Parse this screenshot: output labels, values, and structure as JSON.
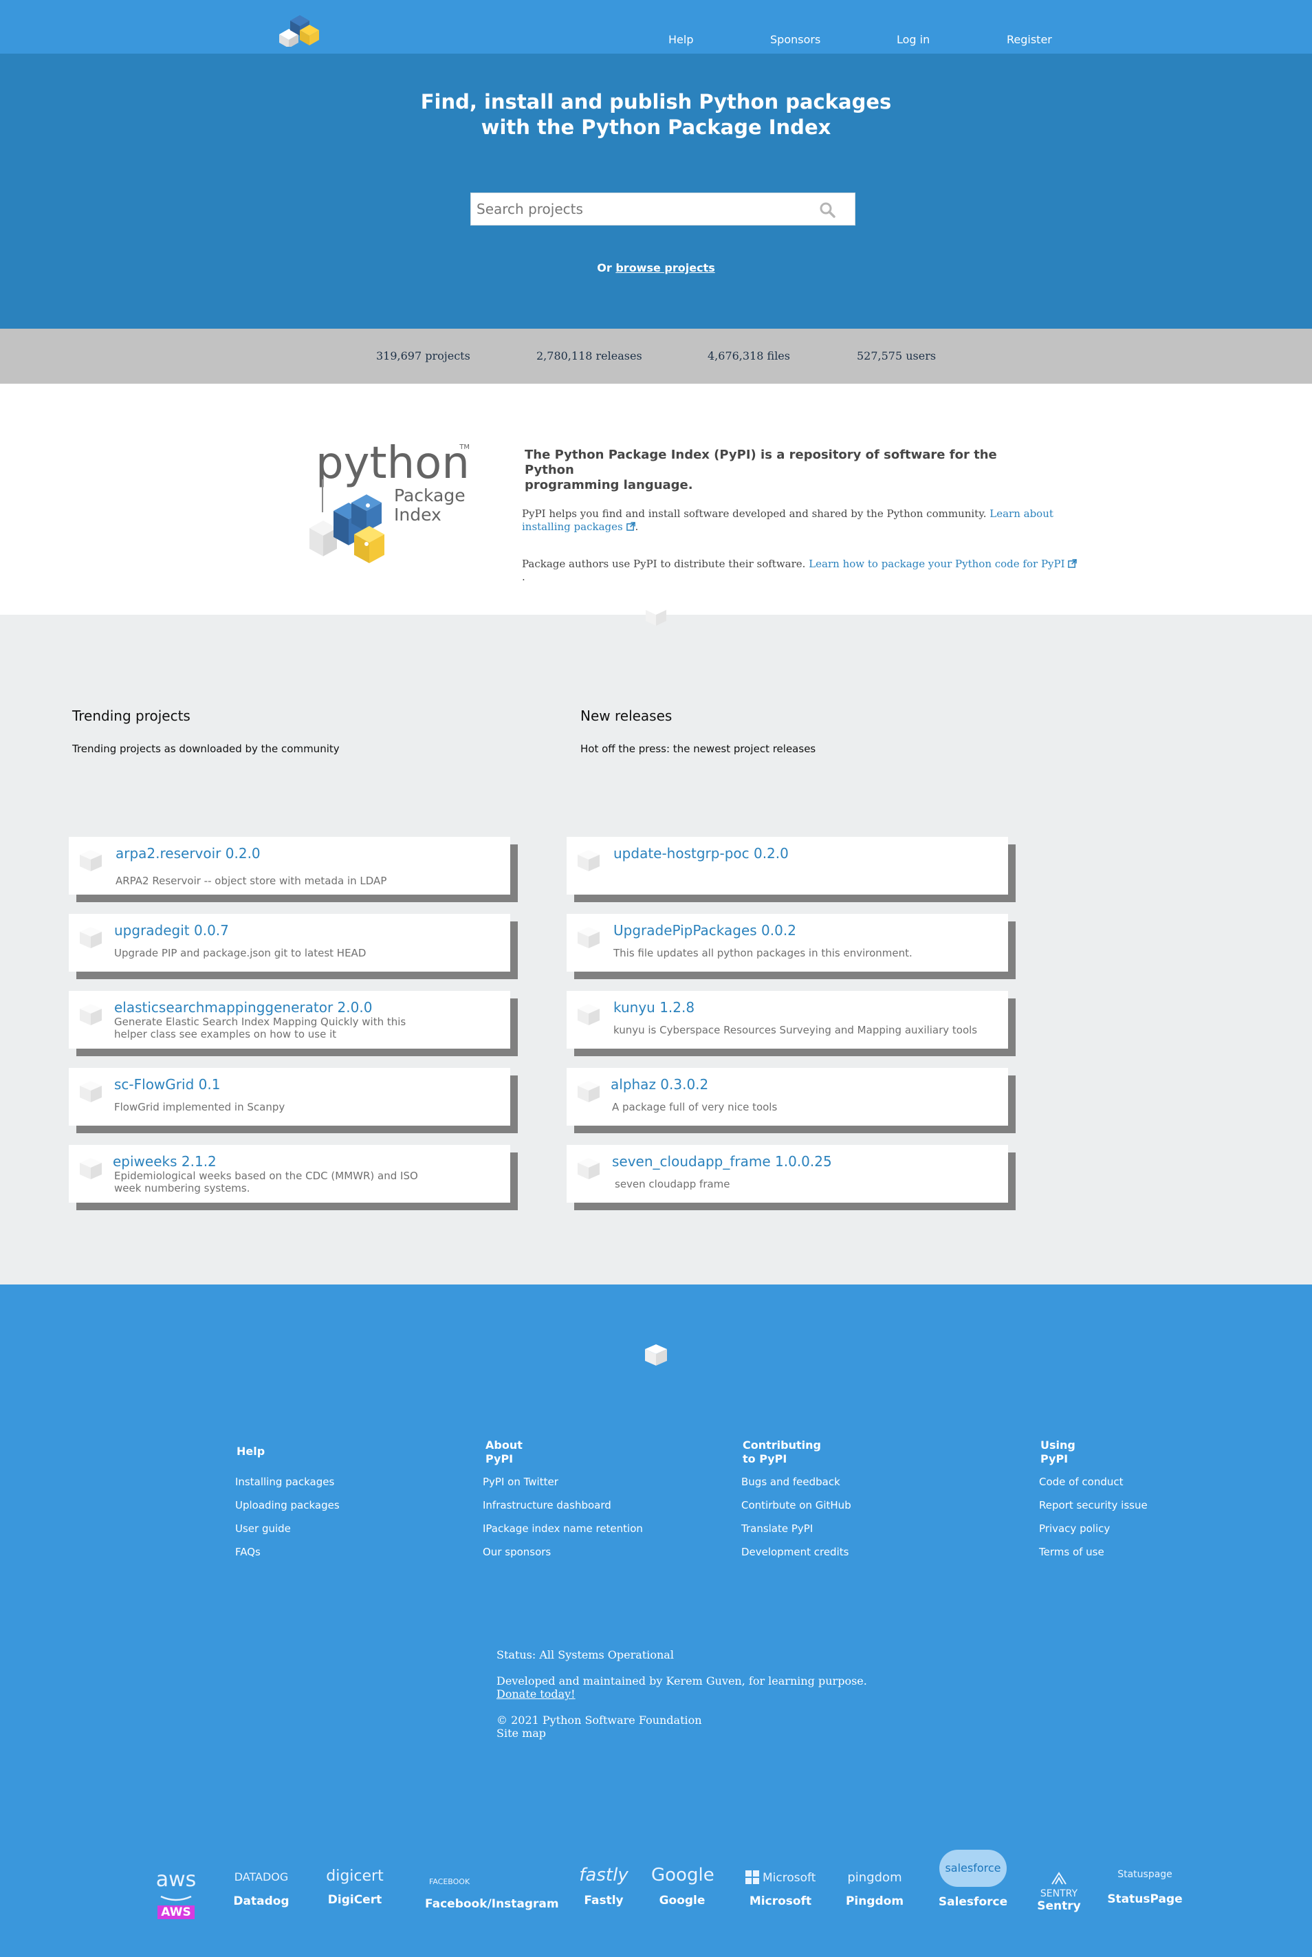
{
  "nav": {
    "logo_alt": "PyPI",
    "links": [
      "Help",
      "Sponsors",
      "Log in",
      "Register"
    ]
  },
  "hero": {
    "title_line1": "Find, install and publish Python packages",
    "title_line2": "with the Python Package Index",
    "search_placeholder": "Search projects",
    "or_text": "Or",
    "browse_link": "browse projects"
  },
  "stats": [
    "319,697 projects",
    "2,780,118 releases",
    "4,676,318 files",
    "527,575 users"
  ],
  "about": {
    "title_line1": "The Python Package Index (PyPI) is a repository of software for the",
    "title_line2": "Python",
    "title_line3": "programming language.",
    "p1_text": "PyPI helps you find and install software developed and shared by the Python community.",
    "p1_link": "Learn about installing packages",
    "p2_text": "Package authors use PyPI to distribute their software.",
    "p2_link": "Learn how to package your Python code for PyPI"
  },
  "trending": {
    "title": "Trending projects",
    "subtitle": "Trending projects as downloaded by the community",
    "items": [
      {
        "name": "arpa2.reservoir 0.2.0",
        "desc": "ARPA2 Reservoir -- object store with metada in LDAP"
      },
      {
        "name": "upgradegit 0.0.7",
        "desc": "Upgrade PIP and package.json git to latest HEAD"
      },
      {
        "name": "elasticsearchmappinggenerator 2.0.0",
        "desc": "Generate Elastic Search Index Mapping Quickly with this helper class see examples on how to use it"
      },
      {
        "name": "sc-FlowGrid 0.1",
        "desc": "FlowGrid implemented in Scanpy"
      },
      {
        "name": "epiweeks 2.1.2",
        "desc": "Epidemiological weeks based on the CDC (MMWR) and ISO week numbering systems."
      }
    ]
  },
  "new_releases": {
    "title": "New releases",
    "subtitle": "Hot off the press: the newest project releases",
    "items": [
      {
        "name": "update-hostgrp-poc 0.2.0",
        "desc": ""
      },
      {
        "name": "UpgradePipPackages 0.0.2",
        "desc": "This file updates all python packages in this environment."
      },
      {
        "name": "kunyu 1.2.8",
        "desc": "kunyu is Cyberspace Resources Surveying and Mapping auxiliary tools"
      },
      {
        "name": "alphaz 0.3.0.2",
        "desc": "A package full of very nice tools"
      },
      {
        "name": "seven_cloudapp_frame 1.0.0.25",
        "desc": "seven cloudapp frame"
      }
    ]
  },
  "footer": {
    "columns": [
      {
        "title_l1": "Help",
        "title_l2": "",
        "links": [
          "Installing packages",
          "Uploading packages",
          "User guide",
          "FAQs"
        ]
      },
      {
        "title_l1": "About",
        "title_l2": "PyPI",
        "links": [
          "PyPI on Twitter",
          "Infrastructure dashboard",
          "IPackage index name retention",
          "Our sponsors"
        ]
      },
      {
        "title_l1": "Contributing",
        "title_l2": "to PyPI",
        "links": [
          "Bugs and feedback",
          "Contirbute on GitHub",
          "Translate PyPI",
          "Development credits"
        ]
      },
      {
        "title_l1": "Using",
        "title_l2": "PyPI",
        "links": [
          "Code of conduct",
          "Report security issue",
          "Privacy policy",
          "Terms of use"
        ]
      }
    ],
    "status": "Status: All Systems Operational",
    "developed": "Developed and maintained by Kerem Guven, for learning purpose.",
    "donate": "Donate today!",
    "copyright": "© 2021 Python Software Foundation",
    "sitemap": "Site map"
  },
  "sponsors": [
    {
      "logo": "aws",
      "name": "AWS"
    },
    {
      "logo": "DATADOG",
      "name": "Datadog"
    },
    {
      "logo": "digicert",
      "name": "DigiCert"
    },
    {
      "logo": "FACEBOOK",
      "name": "Facebook/Instagram"
    },
    {
      "logo": "fastly",
      "name": "Fastly"
    },
    {
      "logo": "Google",
      "name": "Google"
    },
    {
      "logo": "Microsoft",
      "name": "Microsoft"
    },
    {
      "logo": "pingdom",
      "name": "Pingdom"
    },
    {
      "logo": "salesforce",
      "name": "Salesforce"
    },
    {
      "logo": "SENTRY",
      "name": "Sentry"
    },
    {
      "logo": "Statuspage",
      "name": "StatusPage"
    }
  ],
  "colors": {
    "nav_blue": "#3a97dc",
    "hero_blue": "#2b82bd",
    "stats_grey": "#c2c2c2",
    "main_grey": "#eceeef",
    "link_blue": "#2b82bd",
    "aws_badge": "#d63be0"
  }
}
